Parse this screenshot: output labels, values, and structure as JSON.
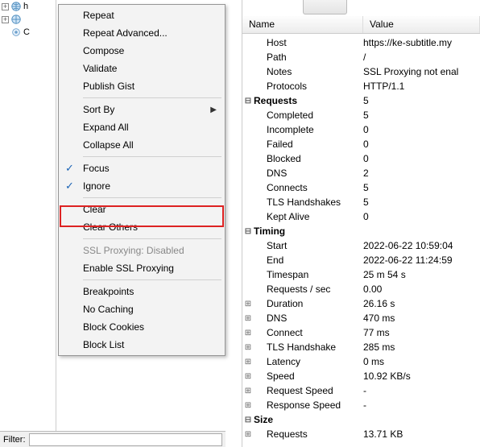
{
  "tree": {
    "row0_label": "h",
    "row1_label": "",
    "row2_label": "C"
  },
  "filter_label": "Filter:",
  "menu": {
    "repeat": "Repeat",
    "repeat_adv": "Repeat Advanced...",
    "compose": "Compose",
    "validate": "Validate",
    "publish": "Publish Gist",
    "sort_by": "Sort By",
    "expand_all": "Expand All",
    "collapse_all": "Collapse All",
    "focus": "Focus",
    "ignore": "Ignore",
    "clear": "Clear",
    "clear_others": "Clear Others",
    "ssl_disabled": "SSL Proxying: Disabled",
    "enable_ssl": "Enable SSL Proxying",
    "breakpoints": "Breakpoints",
    "no_caching": "No Caching",
    "block_cookies": "Block Cookies",
    "block_list": "Block List"
  },
  "headers": {
    "name": "Name",
    "value": "Value"
  },
  "props": [
    {
      "twist": "none",
      "indent": 1,
      "bold": false,
      "name": "Host",
      "value": "https://ke-subtitle.my"
    },
    {
      "twist": "none",
      "indent": 1,
      "bold": false,
      "name": "Path",
      "value": "/"
    },
    {
      "twist": "none",
      "indent": 1,
      "bold": false,
      "name": "Notes",
      "value": "SSL Proxying not enal"
    },
    {
      "twist": "none",
      "indent": 1,
      "bold": false,
      "name": "Protocols",
      "value": "HTTP/1.1"
    },
    {
      "twist": "minus",
      "indent": 0,
      "bold": true,
      "name": "Requests",
      "value": "5"
    },
    {
      "twist": "none",
      "indent": 1,
      "bold": false,
      "name": "Completed",
      "value": "5"
    },
    {
      "twist": "none",
      "indent": 1,
      "bold": false,
      "name": "Incomplete",
      "value": "0"
    },
    {
      "twist": "none",
      "indent": 1,
      "bold": false,
      "name": "Failed",
      "value": "0"
    },
    {
      "twist": "none",
      "indent": 1,
      "bold": false,
      "name": "Blocked",
      "value": "0"
    },
    {
      "twist": "none",
      "indent": 1,
      "bold": false,
      "name": "DNS",
      "value": "2"
    },
    {
      "twist": "none",
      "indent": 1,
      "bold": false,
      "name": "Connects",
      "value": "5"
    },
    {
      "twist": "none",
      "indent": 1,
      "bold": false,
      "name": "TLS Handshakes",
      "value": "5"
    },
    {
      "twist": "none",
      "indent": 1,
      "bold": false,
      "name": "Kept Alive",
      "value": "0"
    },
    {
      "twist": "minus",
      "indent": 0,
      "bold": true,
      "name": "Timing",
      "value": ""
    },
    {
      "twist": "none",
      "indent": 1,
      "bold": false,
      "name": "Start",
      "value": "2022-06-22 10:59:04"
    },
    {
      "twist": "none",
      "indent": 1,
      "bold": false,
      "name": "End",
      "value": "2022-06-22 11:24:59"
    },
    {
      "twist": "none",
      "indent": 1,
      "bold": false,
      "name": "Timespan",
      "value": "25 m 54 s"
    },
    {
      "twist": "none",
      "indent": 1,
      "bold": false,
      "name": "Requests / sec",
      "value": "0.00"
    },
    {
      "twist": "plus",
      "indent": 1,
      "bold": false,
      "name": "Duration",
      "value": "26.16 s"
    },
    {
      "twist": "plus",
      "indent": 1,
      "bold": false,
      "name": "DNS",
      "value": "470 ms"
    },
    {
      "twist": "plus",
      "indent": 1,
      "bold": false,
      "name": "Connect",
      "value": "77 ms"
    },
    {
      "twist": "plus",
      "indent": 1,
      "bold": false,
      "name": "TLS Handshake",
      "value": "285 ms"
    },
    {
      "twist": "plus",
      "indent": 1,
      "bold": false,
      "name": "Latency",
      "value": "0 ms"
    },
    {
      "twist": "plus",
      "indent": 1,
      "bold": false,
      "name": "Speed",
      "value": "10.92 KB/s"
    },
    {
      "twist": "plus",
      "indent": 1,
      "bold": false,
      "name": "Request Speed",
      "value": "-"
    },
    {
      "twist": "plus",
      "indent": 1,
      "bold": false,
      "name": "Response Speed",
      "value": "-"
    },
    {
      "twist": "minus",
      "indent": 0,
      "bold": true,
      "name": "Size",
      "value": ""
    },
    {
      "twist": "plus",
      "indent": 1,
      "bold": false,
      "name": "Requests",
      "value": "13.71 KB"
    }
  ]
}
